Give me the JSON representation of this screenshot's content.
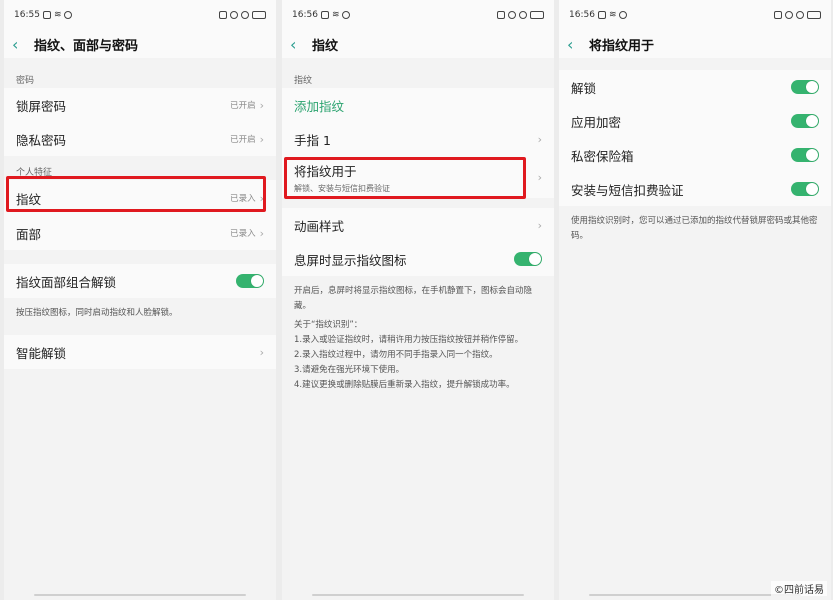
{
  "accent_color": "#2ba36f",
  "highlight_color": "#e0191f",
  "screen1": {
    "time": "16:55",
    "title": "指纹、面部与密码",
    "section_password": "密码",
    "lock_password": {
      "label": "锁屏密码",
      "value": "已开启"
    },
    "private_password": {
      "label": "隐私密码",
      "value": "已开启"
    },
    "section_personal": "个人特征",
    "fingerprint": {
      "label": "指纹",
      "value": "已录入"
    },
    "face": {
      "label": "面部",
      "value": "已录入"
    },
    "combo_unlock": {
      "label": "指纹面部组合解锁",
      "on": true
    },
    "combo_desc": "按压指纹图标，同时启动指纹和人脸解锁。",
    "smart_unlock": {
      "label": "智能解锁"
    }
  },
  "screen2": {
    "time": "16:56",
    "title": "指纹",
    "section_fingerprint": "指纹",
    "add_fingerprint": "添加指纹",
    "finger1": "手指 1",
    "use_fingerprint_for": {
      "label": "将指纹用于",
      "sub": "解锁、安装与短信扣费验证"
    },
    "animation_style": "动画样式",
    "screen_off_icon": {
      "label": "息屏时显示指纹图标",
      "on": true
    },
    "desc_lines": [
      "开启后，息屏时将显示指纹图标，在手机静置下，图标会自动隐藏。",
      "关于“指纹识别”：",
      "1.录入或验证指纹时，请稍许用力按压指纹按钮并稍作停留。",
      "2.录入指纹过程中，请勿用不同手指录入同一个指纹。",
      "3.请避免在强光环境下使用。",
      "4.建议更换或删除贴膜后重新录入指纹，提升解锁成功率。"
    ]
  },
  "screen3": {
    "time": "16:56",
    "title": "将指纹用于",
    "items": [
      {
        "label": "解锁",
        "on": true
      },
      {
        "label": "应用加密",
        "on": true
      },
      {
        "label": "私密保险箱",
        "on": true
      },
      {
        "label": "安装与短信扣费验证",
        "on": true
      }
    ],
    "desc": "使用指纹识别时，您可以通过已添加的指纹代替锁屏密码或其他密码。"
  },
  "watermark": "©四前话易"
}
